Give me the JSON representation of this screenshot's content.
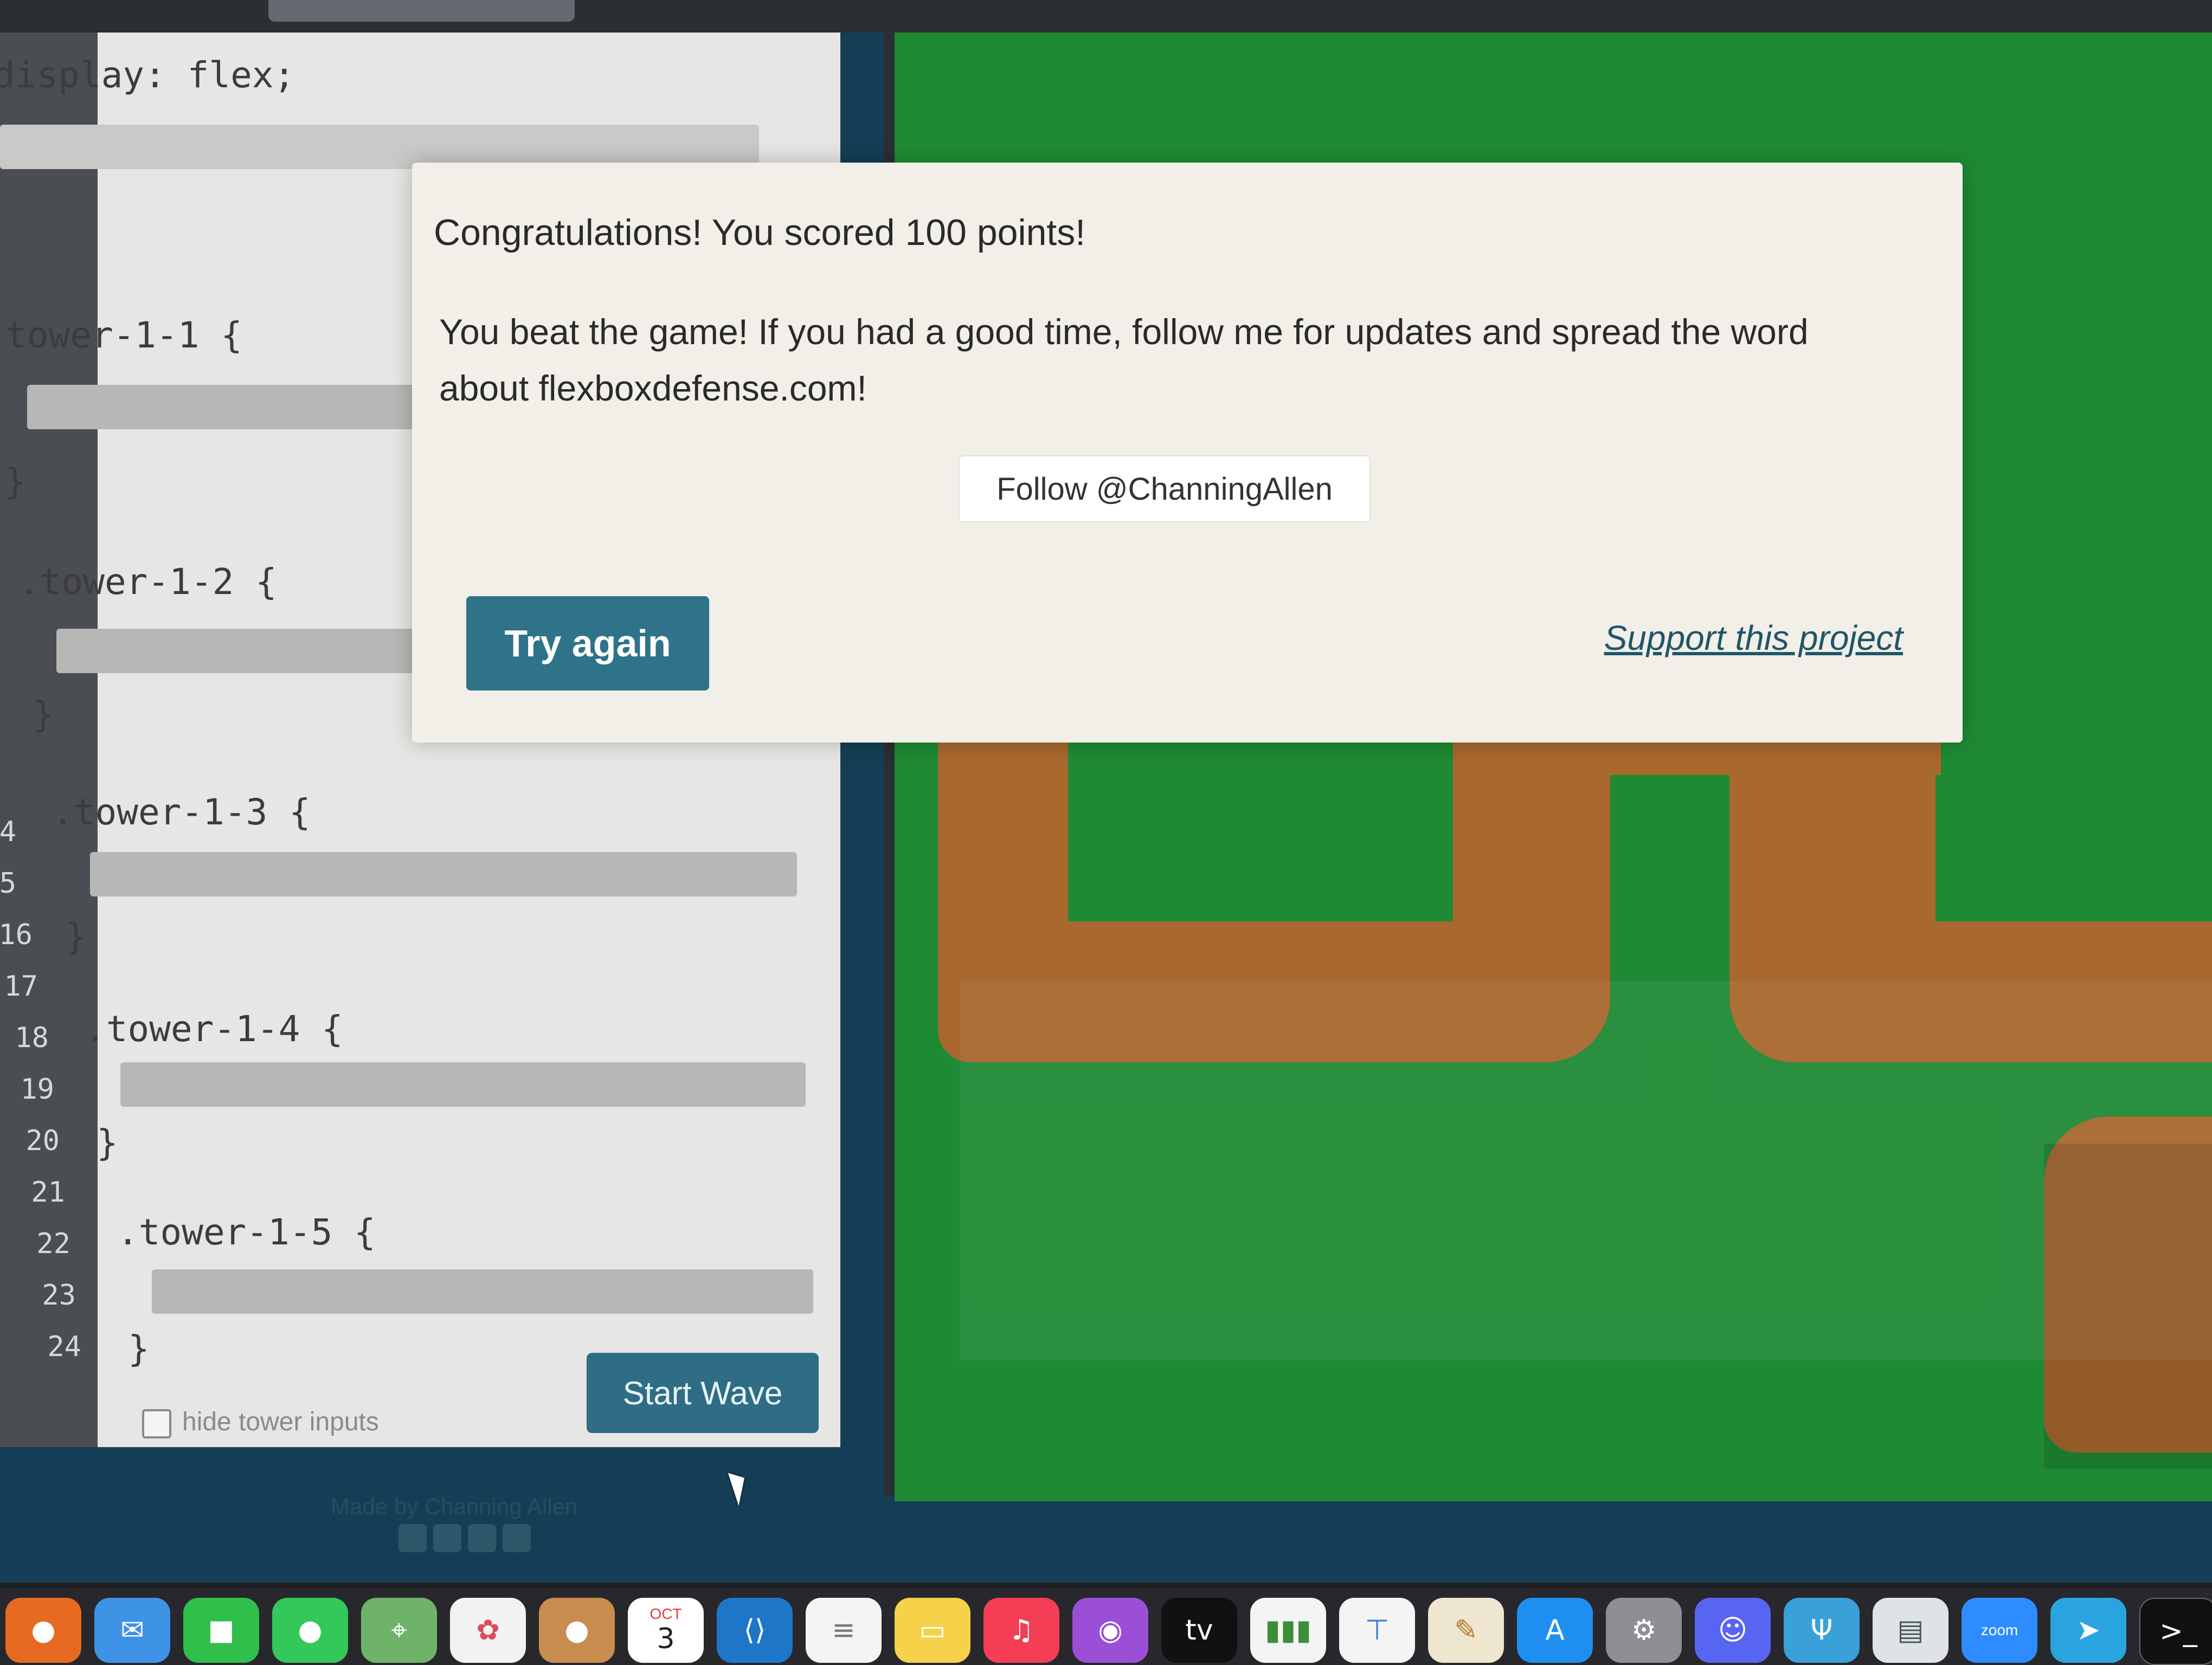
{
  "editor": {
    "code_lines": [
      {
        "line": "",
        "text": "display: flex;"
      },
      {
        "line": "",
        "text": "tower-1-1 {"
      },
      {
        "line": "",
        "text": "}"
      },
      {
        "line": "",
        "text": ".tower-1-2 {"
      },
      {
        "line": "",
        "text": "}"
      },
      {
        "line": "4",
        "text": ".tower-1-3 {"
      },
      {
        "line": "5",
        "text": ""
      },
      {
        "line": "16",
        "text": "}"
      },
      {
        "line": "17",
        "text": ""
      },
      {
        "line": "18",
        "text": ".tower-1-4 {"
      },
      {
        "line": "19",
        "text": ""
      },
      {
        "line": "20",
        "text": "}"
      },
      {
        "line": "21",
        "text": ""
      },
      {
        "line": "22",
        "text": ".tower-1-5 {"
      },
      {
        "line": "23",
        "text": ""
      },
      {
        "line": "24",
        "text": "}"
      }
    ],
    "hide_tower_inputs_label": "hide tower inputs",
    "start_wave_label": "Start Wave",
    "made_by": "Made by Channing Allen"
  },
  "modal": {
    "score_text": "Congratulations! You scored 100 points!",
    "message": "You beat the game! If you had a good time, follow me for updates and spread the word about flexboxdefense.com!",
    "follow_label": "Follow @ChanningAllen",
    "try_again_label": "Try again",
    "support_label": "Support this project"
  },
  "dock": {
    "calendar_month": "OCT",
    "calendar_day": "3",
    "tv_label": "tv",
    "zoom_label": "zoom"
  },
  "colors": {
    "board_green": "#1f8a34",
    "path_brown": "#a8682e",
    "button_teal": "#2e7388",
    "modal_bg": "#f1efe8"
  }
}
